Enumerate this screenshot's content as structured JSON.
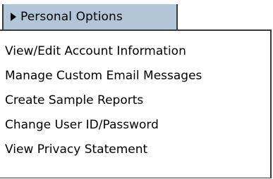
{
  "menu": {
    "header_label": "Personal Options",
    "header_icon": "triangle-right-icon",
    "items": [
      {
        "label": "View/Edit Account Information"
      },
      {
        "label": "Manage Custom Email Messages"
      },
      {
        "label": "Create Sample Reports"
      },
      {
        "label": "Change User ID/Password"
      },
      {
        "label": "View Privacy Statement"
      }
    ]
  },
  "colors": {
    "header_background": "#b2c6da",
    "border": "#3a3a3a",
    "text": "#000000",
    "background": "#ffffff"
  }
}
